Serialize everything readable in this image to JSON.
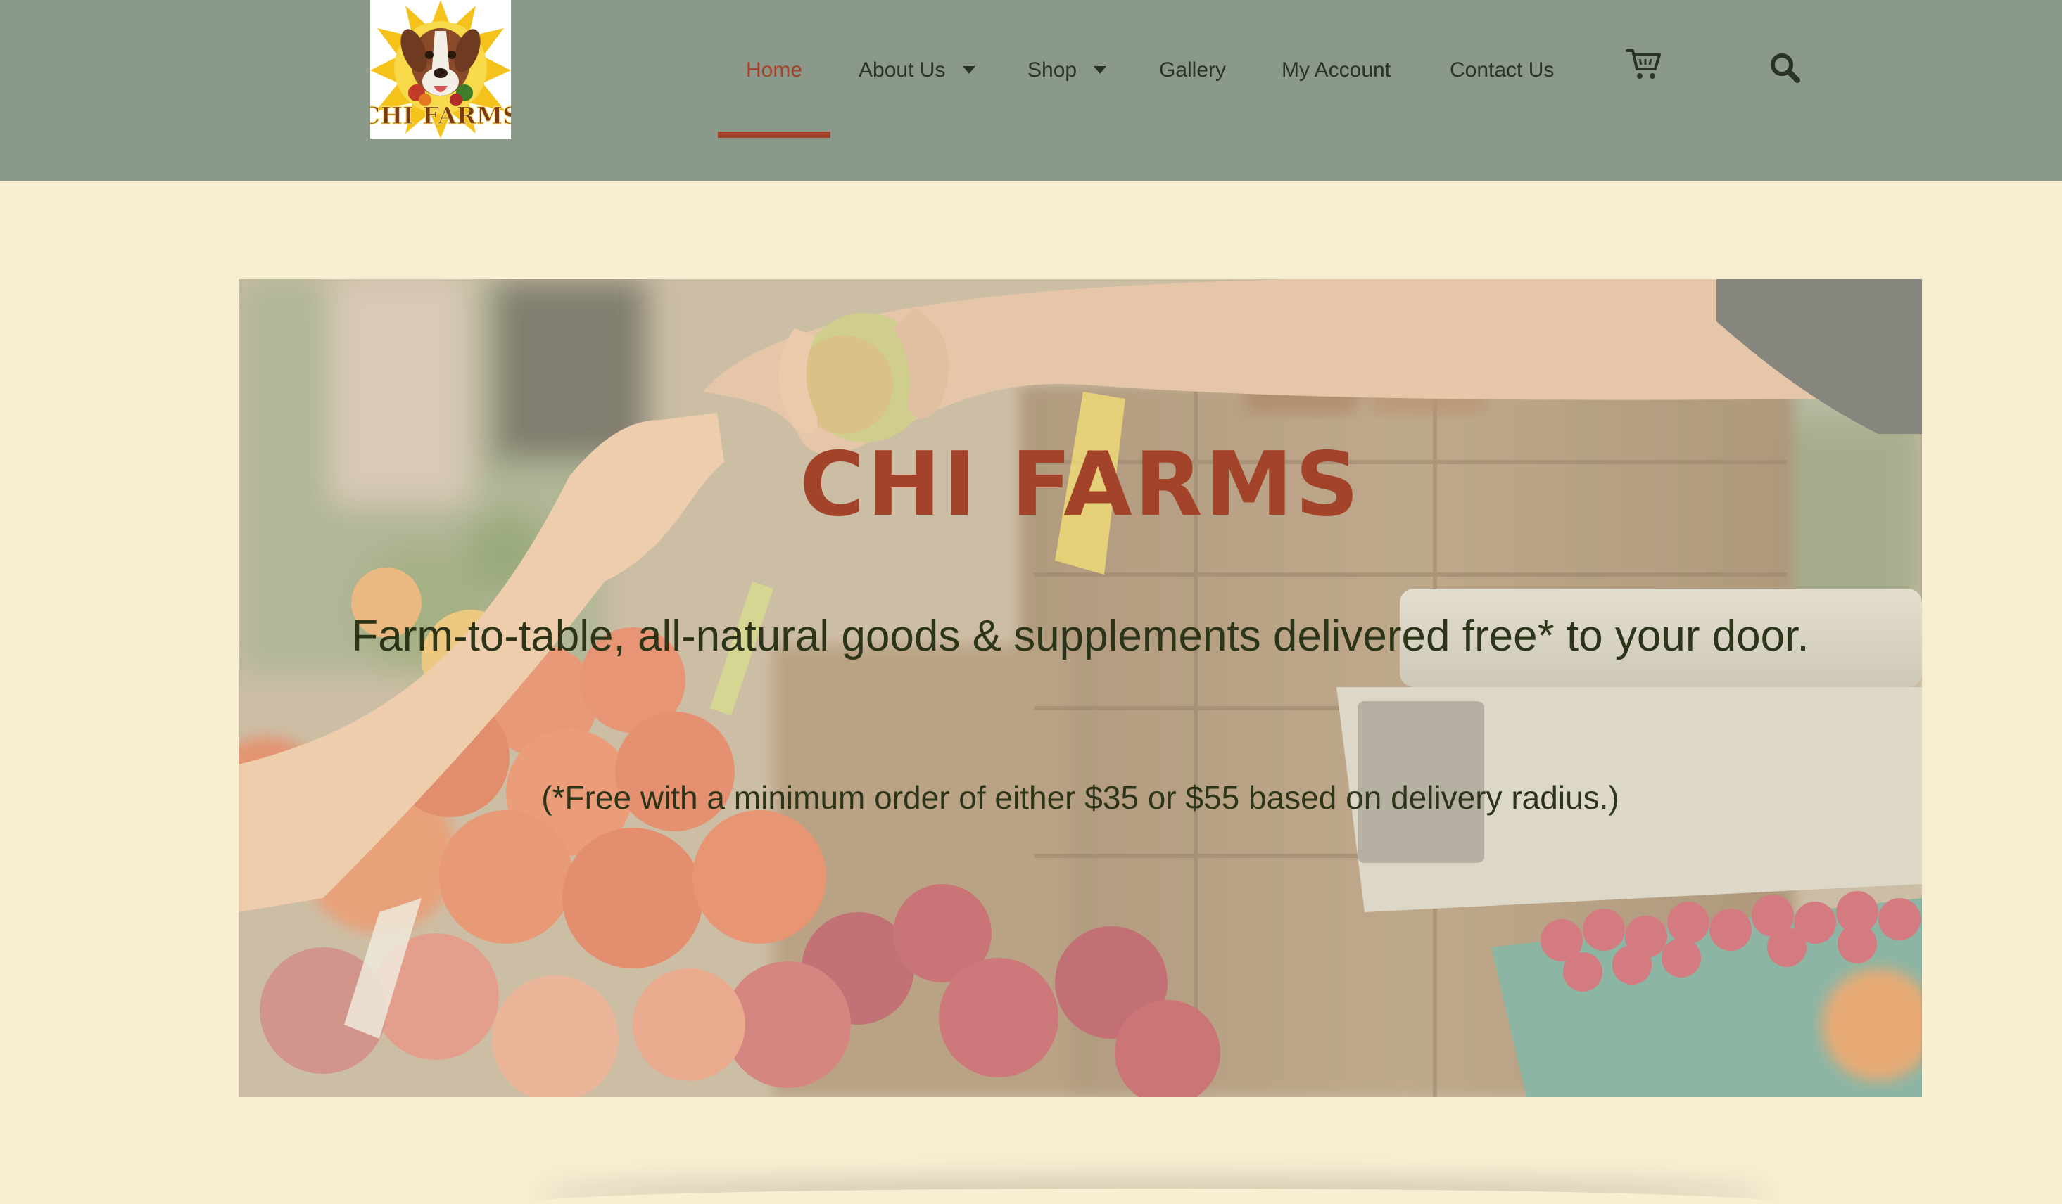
{
  "logo": {
    "alt_text": "CHI FARMS"
  },
  "nav": {
    "items": [
      {
        "label": "Home",
        "active": true,
        "has_dropdown": false
      },
      {
        "label": "About Us",
        "active": false,
        "has_dropdown": true
      },
      {
        "label": "Shop",
        "active": false,
        "has_dropdown": true
      },
      {
        "label": "Gallery",
        "active": false,
        "has_dropdown": false
      },
      {
        "label": "My Account",
        "active": false,
        "has_dropdown": false
      },
      {
        "label": "Contact Us",
        "active": false,
        "has_dropdown": false
      }
    ],
    "cart_icon": "shopping-cart-icon",
    "search_icon": "search-icon"
  },
  "hero": {
    "title": "CHI FARMS",
    "tagline": "Farm-to-table, all-natural goods & supplements delivered free* to your door.",
    "note": "(*Free with a minimum order of either $35 or $55 based on delivery radius.)"
  },
  "colors": {
    "header_bg": "#8b998a",
    "page_bg": "#f8eed2",
    "accent": "#a2432a",
    "text_dark": "#2c3519"
  }
}
